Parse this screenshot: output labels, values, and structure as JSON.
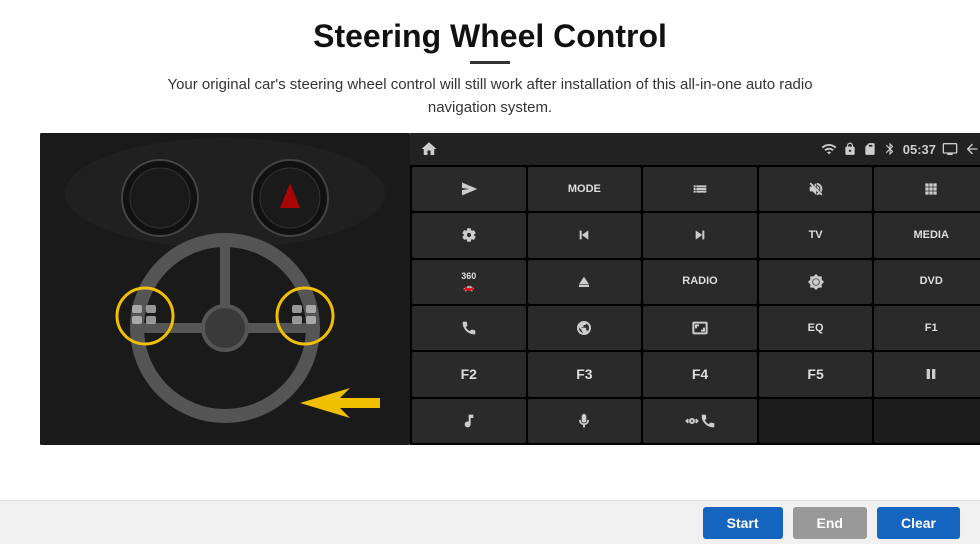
{
  "header": {
    "title": "Steering Wheel Control",
    "subtitle": "Your original car's steering wheel control will still work after installation of this all-in-one auto radio navigation system."
  },
  "topbar": {
    "time": "05:37"
  },
  "grid_buttons": [
    {
      "id": "home",
      "type": "icon",
      "icon": "home",
      "label": ""
    },
    {
      "id": "mode",
      "type": "text",
      "label": "MODE"
    },
    {
      "id": "list",
      "type": "icon",
      "icon": "list",
      "label": ""
    },
    {
      "id": "mute",
      "type": "icon",
      "icon": "mute",
      "label": ""
    },
    {
      "id": "apps",
      "type": "icon",
      "icon": "apps",
      "label": ""
    },
    {
      "id": "nav",
      "type": "icon",
      "icon": "nav",
      "label": ""
    },
    {
      "id": "prev",
      "type": "icon",
      "icon": "prev",
      "label": ""
    },
    {
      "id": "next",
      "type": "icon",
      "icon": "next",
      "label": ""
    },
    {
      "id": "tv",
      "type": "text",
      "label": "TV"
    },
    {
      "id": "media",
      "type": "text",
      "label": "MEDIA"
    },
    {
      "id": "360cam",
      "type": "icon",
      "icon": "360",
      "label": "360"
    },
    {
      "id": "eject",
      "type": "icon",
      "icon": "eject",
      "label": ""
    },
    {
      "id": "radio",
      "type": "text",
      "label": "RADIO"
    },
    {
      "id": "bright",
      "type": "icon",
      "icon": "brightness",
      "label": ""
    },
    {
      "id": "dvd",
      "type": "text",
      "label": "DVD"
    },
    {
      "id": "phone",
      "type": "icon",
      "icon": "phone",
      "label": ""
    },
    {
      "id": "browse",
      "type": "icon",
      "icon": "globe",
      "label": ""
    },
    {
      "id": "aspect",
      "type": "icon",
      "icon": "aspect",
      "label": ""
    },
    {
      "id": "eq",
      "type": "text",
      "label": "EQ"
    },
    {
      "id": "f1",
      "type": "text",
      "label": "F1"
    },
    {
      "id": "f2",
      "type": "text",
      "label": "F2"
    },
    {
      "id": "f3",
      "type": "text",
      "label": "F3"
    },
    {
      "id": "f4",
      "type": "text",
      "label": "F4"
    },
    {
      "id": "f5",
      "type": "text",
      "label": "F5"
    },
    {
      "id": "playpause",
      "type": "icon",
      "icon": "playpause",
      "label": ""
    },
    {
      "id": "music",
      "type": "icon",
      "icon": "music",
      "label": ""
    },
    {
      "id": "mic",
      "type": "icon",
      "icon": "mic",
      "label": ""
    },
    {
      "id": "vol",
      "type": "icon",
      "icon": "vol",
      "label": ""
    },
    {
      "id": "empty1",
      "type": "empty",
      "label": ""
    },
    {
      "id": "empty2",
      "type": "empty",
      "label": ""
    }
  ],
  "bottom_bar": {
    "start_label": "Start",
    "end_label": "End",
    "clear_label": "Clear"
  }
}
